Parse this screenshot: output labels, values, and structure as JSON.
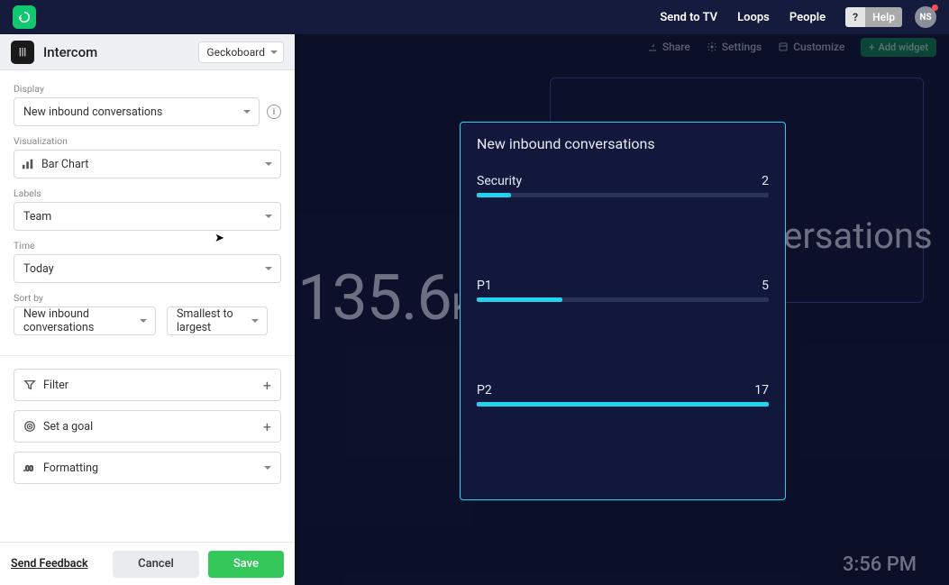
{
  "nav": {
    "send_to_tv": "Send to TV",
    "loops": "Loops",
    "people": "People",
    "help_q": "?",
    "help": "Help",
    "avatar": "NS"
  },
  "toolbar": {
    "share": "Share",
    "settings": "Settings",
    "customize": "Customize",
    "add_widget": "Add widget"
  },
  "panel": {
    "source": "Intercom",
    "account": "Geckoboard",
    "display_label": "Display",
    "display_value": "New inbound conversations",
    "viz_label": "Visualization",
    "viz_value": "Bar Chart",
    "labels_label": "Labels",
    "labels_value": "Team",
    "time_label": "Time",
    "time_value": "Today",
    "sort_label": "Sort by",
    "sort_field": "New inbound conversations",
    "sort_dir": "Smallest to largest",
    "filter": "Filter",
    "goal": "Set a goal",
    "formatting": "Formatting",
    "feedback": "Send Feedback",
    "cancel": "Cancel",
    "save": "Save"
  },
  "bg": {
    "number": "135.6",
    "suffix": "K",
    "right_text": "versations",
    "clock": "3:56 PM"
  },
  "chart_data": {
    "type": "bar",
    "title": "New inbound conversations",
    "categories": [
      "Security",
      "P1",
      "P2"
    ],
    "values": [
      2,
      5,
      17
    ],
    "max": 17,
    "xlabel": "",
    "ylabel": "",
    "ylim": [
      0,
      17
    ]
  }
}
